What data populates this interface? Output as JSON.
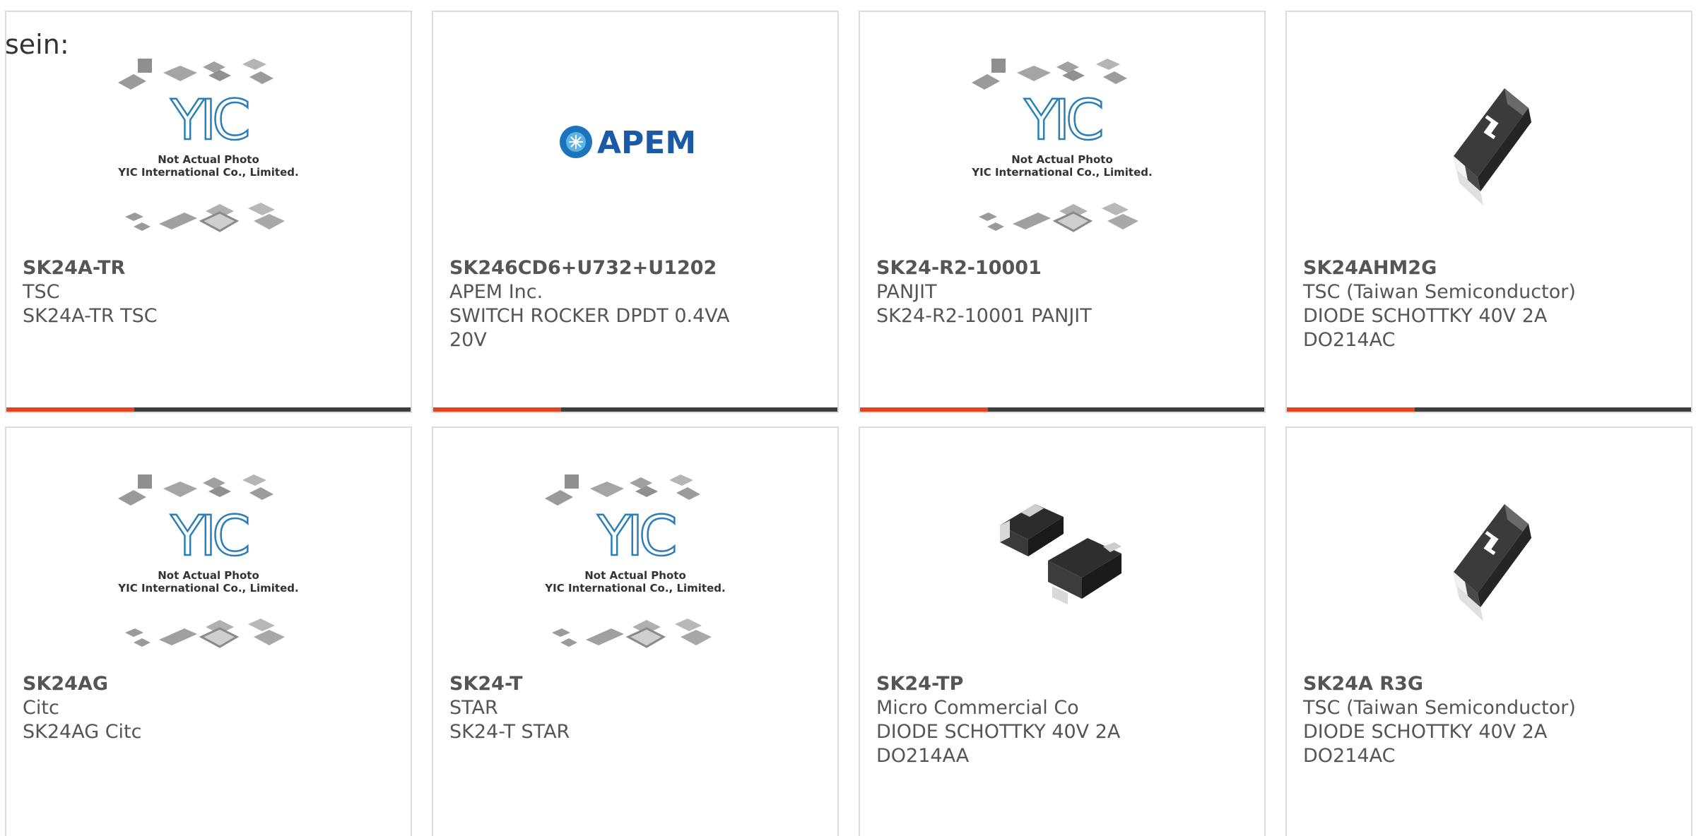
{
  "intro_text": "sein:",
  "placeholder": {
    "brand": "YIC",
    "line1": "Not Actual Photo",
    "line2": "YIC International Co., Limited."
  },
  "apem_logo_text": "APEM",
  "colors": {
    "accent": "#e8431a",
    "bar_dark": "#3d3d3d",
    "text": "#555555",
    "border": "#dcdcdc"
  },
  "products": [
    {
      "part": "SK24A-TR",
      "maker": "TSC",
      "desc": "SK24A-TR TSC",
      "image": "yic-placeholder-icon"
    },
    {
      "part": "SK246CD6+U732+U1202",
      "maker": "APEM Inc.",
      "desc": "SWITCH ROCKER DPDT 0.4VA 20V",
      "image": "apem-logo"
    },
    {
      "part": "SK24-R2-10001",
      "maker": "PANJIT",
      "desc": "SK24-R2-10001 PANJIT",
      "image": "yic-placeholder-icon"
    },
    {
      "part": "SK24AHM2G",
      "maker": "TSC (Taiwan Semiconductor)",
      "desc": "DIODE SCHOTTKY 40V 2A DO214AC",
      "image": "tsc-diode-icon"
    },
    {
      "part": "SK24AG",
      "maker": "Citc",
      "desc": "SK24AG Citc",
      "image": "yic-placeholder-icon"
    },
    {
      "part": "SK24-T",
      "maker": "STAR",
      "desc": "SK24-T STAR",
      "image": "yic-placeholder-icon"
    },
    {
      "part": "SK24-TP",
      "maker": "Micro Commercial Co",
      "desc": "DIODE SCHOTTKY 40V 2A DO214AA",
      "image": "smd-diode-pair-icon"
    },
    {
      "part": "SK24A R3G",
      "maker": "TSC (Taiwan Semiconductor)",
      "desc": "DIODE SCHOTTKY 40V 2A DO214AC",
      "image": "tsc-diode-icon"
    }
  ]
}
